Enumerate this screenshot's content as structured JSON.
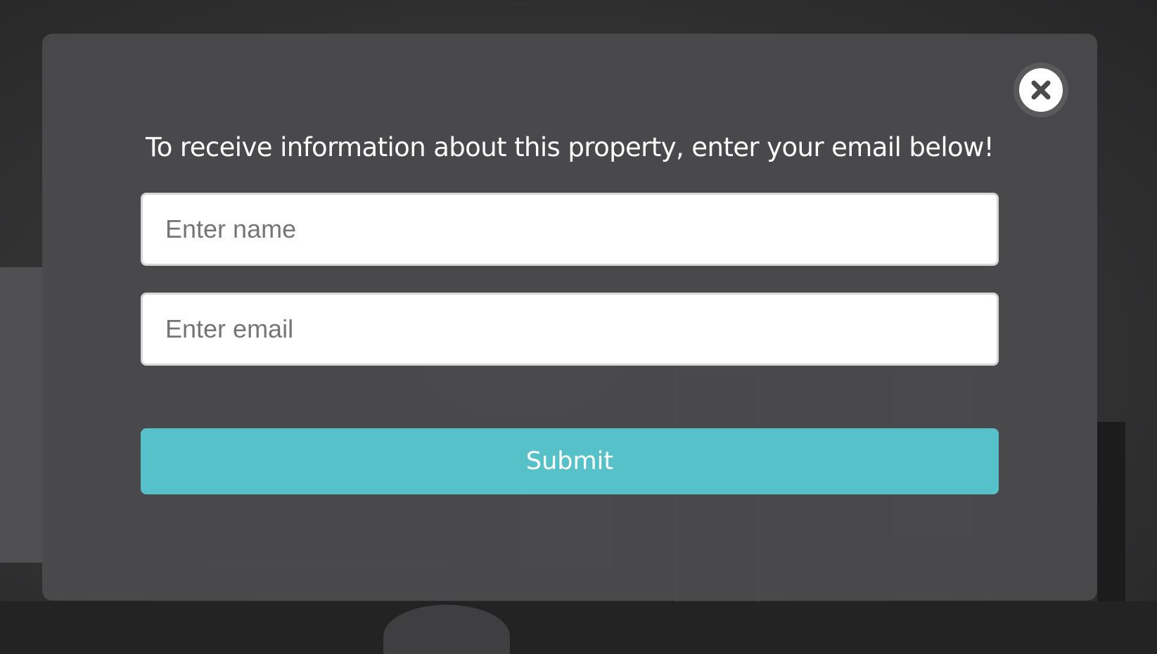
{
  "modal": {
    "prompt": "To receive information about this property, enter your email below!",
    "close_icon": "close-icon",
    "name_field": {
      "placeholder": "Enter name",
      "value": ""
    },
    "email_field": {
      "placeholder": "Enter email",
      "value": ""
    },
    "submit_label": "Submit"
  },
  "colors": {
    "overlay": "#4a4a4c",
    "accent": "#57c1c9",
    "text": "#ffffff"
  }
}
